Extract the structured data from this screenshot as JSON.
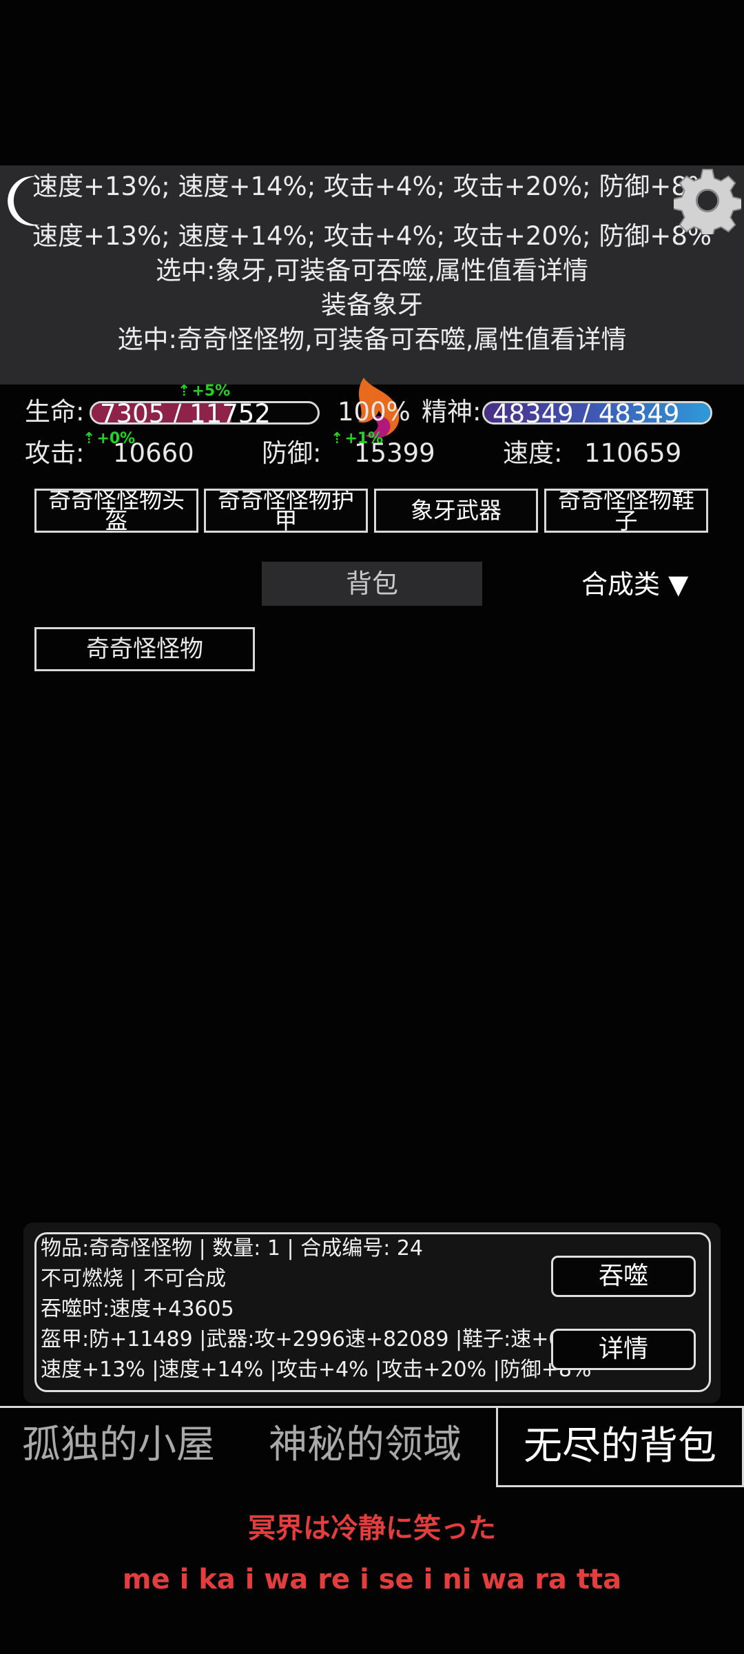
{
  "log": {
    "lines": [
      "速度+13%; 速度+14%; 攻击+4%; 攻击+20%; 防御+8%",
      "速度+13%; 速度+14%; 攻击+4%; 攻击+20%; 防御+8%",
      "选中:象牙,可装备可吞噬,属性值看详情",
      "装备象牙",
      "选中:奇奇怪怪物,可装备可吞噬,属性值看详情"
    ]
  },
  "icons": {
    "moon": "moon-icon",
    "settings": "gear-icon",
    "flame": "flame-icon"
  },
  "stats": {
    "hp_label": "生命:",
    "hp_value": "7305 / 11752",
    "hp_fraction": 0.62,
    "hp_color": "#8e2249",
    "hp_buff": "+5%",
    "percent": "100%",
    "mp_label": "精神:",
    "mp_value": "48349 / 48349",
    "mp_fraction": 1.0,
    "atk_label": "攻击:",
    "atk_value": "10660",
    "atk_buff": "+0%",
    "def_label": "防御:",
    "def_value": "15399",
    "def_buff": "+1%",
    "spd_label": "速度:",
    "spd_value": "110659"
  },
  "equipment": {
    "helmet": "奇奇怪怪物头盔",
    "armor": "奇奇怪怪物护甲",
    "weapon": "象牙武器",
    "shoes": "奇奇怪怪物鞋子"
  },
  "bag": {
    "tab_label": "背包",
    "filter_label": "合成类 ▼",
    "items": [
      "奇奇怪怪物"
    ]
  },
  "detail": {
    "line1": "物品:奇奇怪怪物 | 数量: 1 | 合成编号: 24",
    "line2": "不可燃烧 | 不可合成",
    "line3": "吞噬时:速度+43605",
    "line4": "盔甲:防+11489 |武器:攻+2996速+82089 |鞋子:速+0",
    "line5": "速度+13% |速度+14% |攻击+4% |攻击+20% |防御+8%",
    "devour_label": "吞噬",
    "details_label": "详情"
  },
  "nav": {
    "tab1": "孤独的小屋",
    "tab2": "神秘的领域",
    "tab3": "无尽的背包"
  },
  "subtitle": {
    "japanese": "冥界は冷静に笑った",
    "romaji": "me i ka i wa re i se i ni wa ra tta"
  },
  "colors": {
    "accent_red": "#e43d3d",
    "buff_green": "#22d422",
    "panel_bg": "#2a2a2c"
  }
}
